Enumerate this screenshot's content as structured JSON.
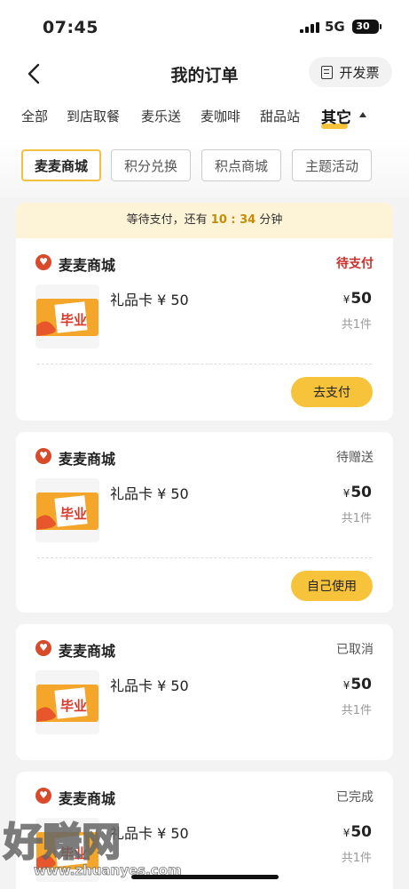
{
  "status_bar": {
    "time": "07:45",
    "network": "5G",
    "battery": "30"
  },
  "header": {
    "title": "我的订单",
    "invoice_label": "开发票"
  },
  "tabs": [
    {
      "label": "全部"
    },
    {
      "label": "到店取餐"
    },
    {
      "label": "麦乐送"
    },
    {
      "label": "麦咖啡"
    },
    {
      "label": "甜品站"
    },
    {
      "label": "其它",
      "active": true
    }
  ],
  "subfilters": [
    {
      "label": "麦麦商城",
      "active": true
    },
    {
      "label": "积分兑换"
    },
    {
      "label": "积点商城"
    },
    {
      "label": "主题活动"
    }
  ],
  "pay_banner": {
    "prefix": "等待支付，还有",
    "countdown": "10 : 34",
    "suffix": "分钟"
  },
  "orders": [
    {
      "store": "麦麦商城",
      "status": "待支付",
      "product": "礼品卡 ¥ 50",
      "currency": "¥",
      "price": "50",
      "qty": "共1件",
      "action": "去支付"
    },
    {
      "store": "麦麦商城",
      "status": "待赠送",
      "product": "礼品卡 ¥ 50",
      "currency": "¥",
      "price": "50",
      "qty": "共1件",
      "action": "自己使用"
    },
    {
      "store": "麦麦商城",
      "status": "已取消",
      "product": "礼品卡 ¥ 50",
      "currency": "¥",
      "price": "50",
      "qty": "共1件"
    },
    {
      "store": "麦麦商城",
      "status": "已完成",
      "product": "礼品卡 ¥ 50",
      "currency": "¥",
      "price": "50",
      "qty": "共1件"
    }
  ],
  "gift_card_art_text": "毕业",
  "watermark": {
    "brand": "好赚网",
    "domain": "www.zhuanyes.com"
  },
  "colors": {
    "accent": "#f6c33b",
    "banner_bg": "#fdf3d7",
    "status_red": "#c9302c"
  }
}
